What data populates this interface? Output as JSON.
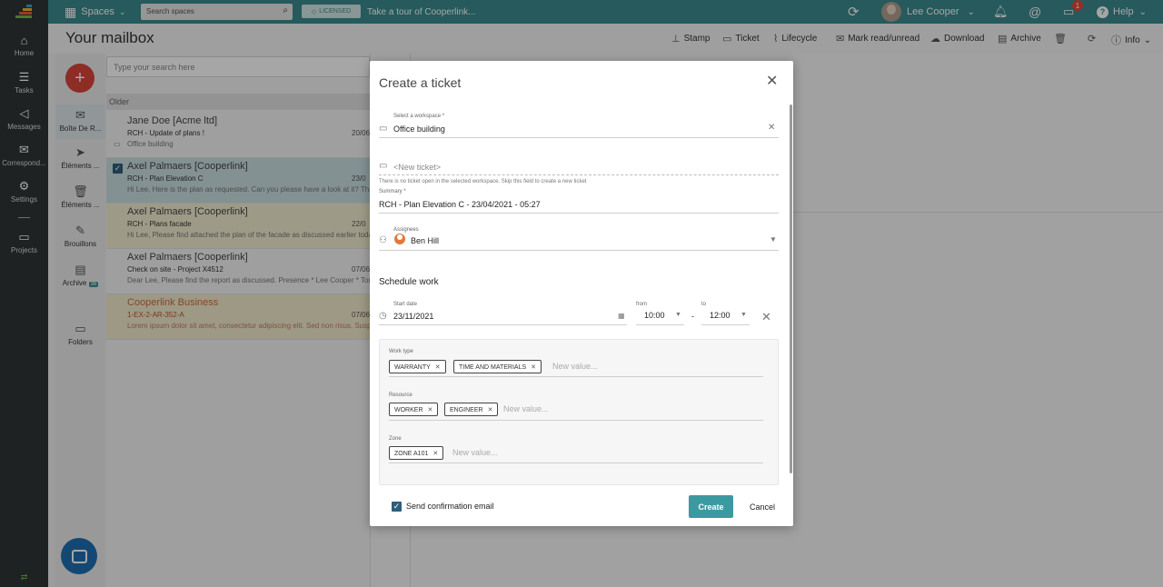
{
  "topbar": {
    "spaces_label": "Spaces",
    "search_placeholder": "Search spaces",
    "licensed": "LICENSED",
    "tour": "Take a tour of Cooperlink...",
    "user": "Lee Cooper",
    "notif_count": "1",
    "help": "Help"
  },
  "leftnav": {
    "items": [
      {
        "label": "Home",
        "icon": "home-icon"
      },
      {
        "label": "Tasks",
        "icon": "tasks-icon"
      },
      {
        "label": "Messages",
        "icon": "megaphone-icon"
      },
      {
        "label": "Correspond...",
        "icon": "mail-icon"
      },
      {
        "label": "Settings",
        "icon": "gear-icon"
      },
      {
        "label": "Projects",
        "icon": "folder-icon"
      }
    ]
  },
  "mailbox": {
    "title": "Your mailbox",
    "toolbar": [
      "Stamp",
      "Ticket",
      "Lifecycle",
      "Mark read/unread",
      "Download",
      "Archive",
      "Info"
    ],
    "search_placeholder": "Type your search here",
    "group": "Older",
    "folders": [
      {
        "label": "Boîte De R..."
      },
      {
        "label": "Éléments ..."
      },
      {
        "label": "Éléments ..."
      },
      {
        "label": "Brouillons"
      },
      {
        "label": "Archive",
        "count": "36"
      },
      {
        "label": "Folders"
      }
    ],
    "messages": [
      {
        "from": "Jane Doe [Acme ltd]",
        "subject": "RCH - Update of plans !",
        "preview": "Office building",
        "date": "20/06"
      },
      {
        "from": "Axel Palmaers [Cooperlink]",
        "subject": "RCH - Plan Elevation C",
        "preview": "Hi Lee, Here is the plan as requested. Can you please have a look at it? Thank y",
        "date": "23/0"
      },
      {
        "from": "Axel Palmaers [Cooperlink]",
        "subject": "RCH - Plans facade",
        "preview": "Hi Lee, Please find attached the plan of the facade as discussed earlier today.",
        "date": "22/0"
      },
      {
        "from": "Axel Palmaers [Cooperlink]",
        "subject": "Check on site - Project X4512",
        "preview": "Dear Lee, Please find the report as discussed. Presence * Lee Cooper * Tom Ins",
        "date": "07/06"
      },
      {
        "from": "Cooperlink Business",
        "subject": "1-EX-2-AR-352-A",
        "preview": "Lorem ipsum dolor sit amet, consectetur adipiscing elit. Sed non risus. Suspen",
        "date": "07/06"
      }
    ]
  },
  "modal": {
    "title": "Create a ticket",
    "workspace_label": "Select a workspace *",
    "workspace_value": "Office building",
    "ticket_value": "<New ticket>",
    "ticket_hint": "There is no ticket open in the selected workspace. Skip this field to create a new ticket",
    "summary_label": "Summary *",
    "summary_value": "RCH - Plan Elevation C - 23/04/2021 - 05:27",
    "assignees_label": "Assignees",
    "assignee": "Ben Hill",
    "schedule_title": "Schedule work",
    "start_label": "Start date",
    "start_value": "23/11/2021",
    "from_label": "from",
    "from_value": "10:00",
    "dash": "-",
    "to_label": "to",
    "to_value": "12:00",
    "work_type_label": "Work type",
    "work_types": [
      "WARRANTY",
      "TIME AND MATERIALS"
    ],
    "resource_label": "Resource",
    "resources": [
      "WORKER",
      "ENGINEER"
    ],
    "zone_label": "Zone",
    "zones": [
      "ZONE A101"
    ],
    "new_value": "New value...",
    "confirm_label": "Send confirmation email",
    "create": "Create",
    "cancel": "Cancel"
  }
}
